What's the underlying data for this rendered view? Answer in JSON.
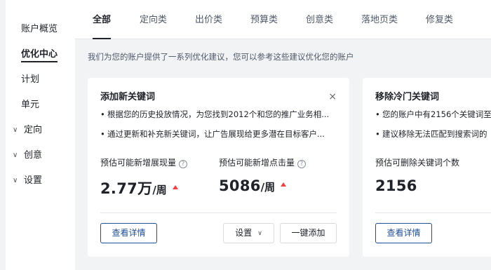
{
  "sidebar": {
    "items": [
      {
        "label": "账户概览"
      },
      {
        "label": "优化中心"
      },
      {
        "label": "计划"
      },
      {
        "label": "单元"
      },
      {
        "label": "定向"
      },
      {
        "label": "创意"
      },
      {
        "label": "设置"
      }
    ]
  },
  "tabs": [
    "全部",
    "定向类",
    "出价类",
    "预算类",
    "创意类",
    "落地页类",
    "修复类"
  ],
  "active_tab": "全部",
  "subtitle": "我们为您的账户提供了一系列优化建议，您可以参考这些建议优化您的账户",
  "cards": [
    {
      "title": "添加新关键词",
      "close": "×",
      "bullets": [
        "根据您的历史投放情况，为您找到2012个和您的推广业务相...",
        "通过更新和补充新关键词，让广告展现给更多潜在目标客户..."
      ],
      "metrics": [
        {
          "label": "预估可能新增展现量",
          "value": "2.77万",
          "unit": "/周",
          "trend": "up"
        },
        {
          "label": "预估可能新增点击量",
          "value": "5086",
          "unit": "/周",
          "trend": "up"
        }
      ],
      "buttons": {
        "detail": "查看详情",
        "settings": "设置",
        "add": "一键添加"
      }
    },
    {
      "title": "移除冷门关键词",
      "bullets": [
        "您的账户中有2156个关键词至",
        "建议移除无法匹配到搜索词的"
      ],
      "metrics": [
        {
          "label": "预估可删除关键词个数",
          "value": "2156"
        }
      ],
      "buttons": {
        "detail": "查看详情"
      }
    }
  ],
  "colors": {
    "accent": "#1d4f9c",
    "trend_up": "#f53f3f",
    "background": "#f2f3f5"
  },
  "icons": {
    "close": "close-icon",
    "help": "help-circle-icon",
    "trend": "trend-up-icon",
    "expand": "chevron-down-icon"
  }
}
